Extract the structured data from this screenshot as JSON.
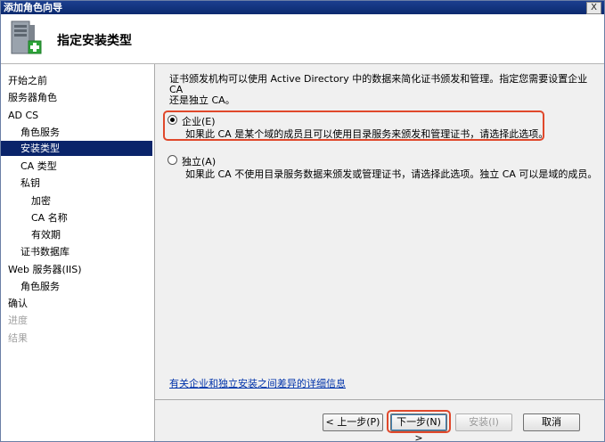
{
  "window": {
    "title": "添加角色向导",
    "close_label": "X"
  },
  "header": {
    "title": "指定安装类型"
  },
  "sidebar": {
    "items": [
      {
        "label": "开始之前",
        "level": 0,
        "state": "normal"
      },
      {
        "label": "服务器角色",
        "level": 0,
        "state": "normal"
      },
      {
        "label": "AD CS",
        "level": 0,
        "state": "normal"
      },
      {
        "label": "角色服务",
        "level": 1,
        "state": "normal"
      },
      {
        "label": "安装类型",
        "level": 1,
        "state": "active"
      },
      {
        "label": "CA 类型",
        "level": 1,
        "state": "normal"
      },
      {
        "label": "私钥",
        "level": 1,
        "state": "normal"
      },
      {
        "label": "加密",
        "level": 2,
        "state": "normal"
      },
      {
        "label": "CA 名称",
        "level": 2,
        "state": "normal"
      },
      {
        "label": "有效期",
        "level": 2,
        "state": "normal"
      },
      {
        "label": "证书数据库",
        "level": 1,
        "state": "normal"
      },
      {
        "label": "Web 服务器(IIS)",
        "level": 0,
        "state": "normal"
      },
      {
        "label": "角色服务",
        "level": 1,
        "state": "normal"
      },
      {
        "label": "确认",
        "level": 0,
        "state": "normal"
      },
      {
        "label": "进度",
        "level": 0,
        "state": "disabled"
      },
      {
        "label": "结果",
        "level": 0,
        "state": "disabled"
      }
    ]
  },
  "main": {
    "description_line1": "证书颁发机构可以使用 Active Directory 中的数据来简化证书颁发和管理。指定您需要设置企业 CA",
    "description_line2": "还是独立 CA。",
    "options": [
      {
        "label": "企业(E)",
        "description": "如果此 CA 是某个域的成员且可以使用目录服务来颁发和管理证书，请选择此选项。",
        "selected": true
      },
      {
        "label": "独立(A)",
        "description": "如果此 CA 不使用目录服务数据来颁发或管理证书，请选择此选项。独立 CA 可以是域的成员。",
        "selected": false
      }
    ],
    "more_info_link": "有关企业和独立安装之间差异的详细信息"
  },
  "footer": {
    "back_label": "< 上一步(P)",
    "next_label": "下一步(N) >",
    "install_label": "安装(I)",
    "cancel_label": "取消"
  },
  "colors": {
    "highlight": "#e0482b",
    "selection": "#0a246a",
    "link": "#0033aa",
    "titlebar": "#0b2a6f"
  }
}
